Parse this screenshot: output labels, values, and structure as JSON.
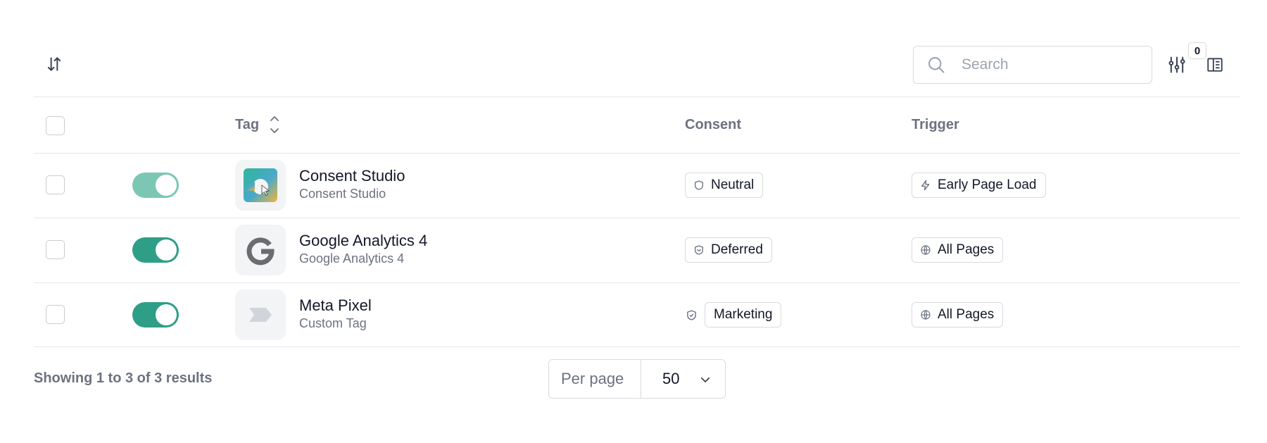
{
  "toolbar": {
    "sort_icon": "sort-arrows-icon",
    "search": {
      "placeholder": "Search",
      "value": ""
    },
    "filter_icon": "sliders-icon",
    "filter_count": "0",
    "columns_icon": "columns-panel-icon"
  },
  "table": {
    "columns": {
      "tag": "Tag",
      "consent": "Consent",
      "trigger": "Trigger"
    },
    "rows": [
      {
        "enabled": true,
        "toggle_color": "#7bc7b4",
        "logo": "consent-studio-logo",
        "name": "Consent Studio",
        "subtitle": "Consent Studio",
        "consent": "Neutral",
        "consent_icon": "shield-icon",
        "trigger": "Early Page Load",
        "trigger_icon": "lightning-icon"
      },
      {
        "enabled": true,
        "toggle_color": "#2f9e86",
        "logo": "google-g-logo",
        "name": "Google Analytics 4",
        "subtitle": "Google Analytics 4",
        "consent": "Deferred",
        "consent_icon": "shield-deferred-icon",
        "trigger": "All Pages",
        "trigger_icon": "globe-icon"
      },
      {
        "enabled": true,
        "toggle_color": "#2f9e86",
        "logo": "custom-tag-logo",
        "name": "Meta Pixel",
        "subtitle": "Custom Tag",
        "consent": "Marketing",
        "consent_icon": "shield-check-icon",
        "trigger": "All Pages",
        "trigger_icon": "globe-icon"
      }
    ]
  },
  "footer": {
    "summary": "Showing 1 to 3 of 3 results",
    "per_page_label": "Per page",
    "per_page_value": "50"
  }
}
